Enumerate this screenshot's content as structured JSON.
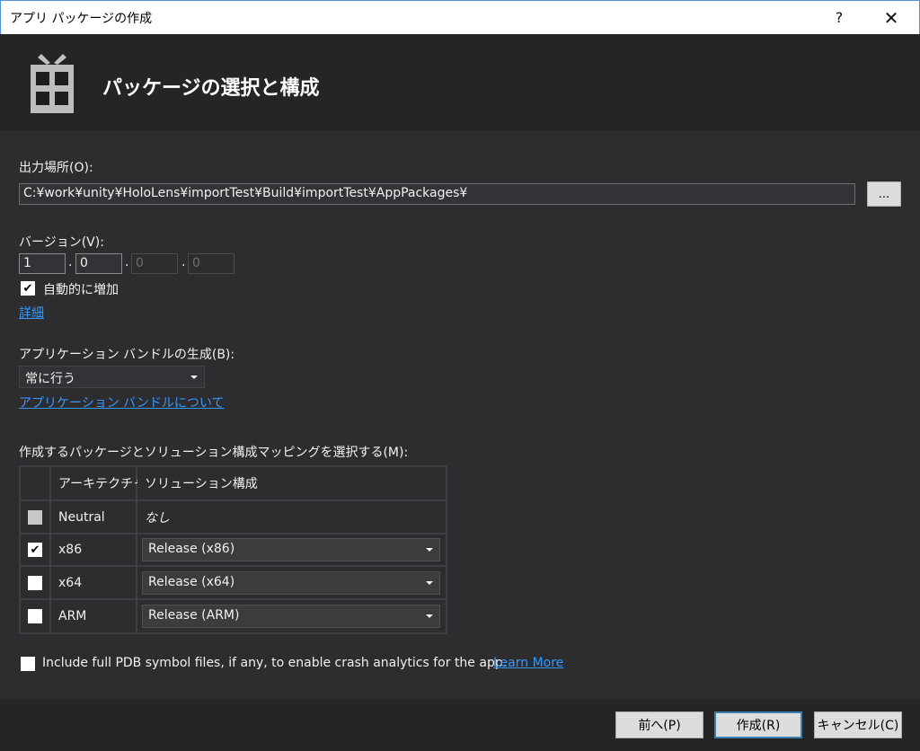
{
  "window": {
    "title": "アプリ パッケージの作成",
    "help_label": "?",
    "close_label": "✕"
  },
  "header": {
    "heading": "パッケージの選択と構成",
    "icon": "package-gift-icon"
  },
  "output": {
    "label": "出力場所(O):",
    "path": "C:¥work¥unity¥HoloLens¥importTest¥Build¥importTest¥AppPackages¥",
    "browse_label": "..."
  },
  "version": {
    "label": "バージョン(V):",
    "parts": [
      "1",
      "0",
      "0",
      "0"
    ],
    "separator": ".",
    "auto_increment_label": "自動的に増加",
    "auto_increment_checked": true,
    "details_link": "詳細"
  },
  "bundle": {
    "label": "アプリケーション バンドルの生成(B):",
    "selected": "常に行う",
    "about_link": "アプリケーション バンドルについて"
  },
  "mapping": {
    "label": "作成するパッケージとソリューション構成マッピングを選択する(M):",
    "columns": [
      "アーキテクチャ",
      "ソリューション構成"
    ],
    "rows": [
      {
        "checked": false,
        "disabled": true,
        "arch": "Neutral",
        "config": "なし"
      },
      {
        "checked": true,
        "disabled": false,
        "arch": "x86",
        "config": "Release (x86)"
      },
      {
        "checked": false,
        "disabled": false,
        "arch": "x64",
        "config": "Release (x64)"
      },
      {
        "checked": false,
        "disabled": false,
        "arch": "ARM",
        "config": "Release (ARM)"
      }
    ]
  },
  "pdb": {
    "label": "Include full PDB symbol files, if any, to enable crash analytics for the app.",
    "link": "Learn More",
    "checked": false
  },
  "buttons": {
    "back": "前へ(P)",
    "create": "作成(R)",
    "cancel": "キャンセル(C)"
  },
  "colors": {
    "background": "#2d2d30",
    "header": "#252526",
    "link": "#3399ff"
  }
}
